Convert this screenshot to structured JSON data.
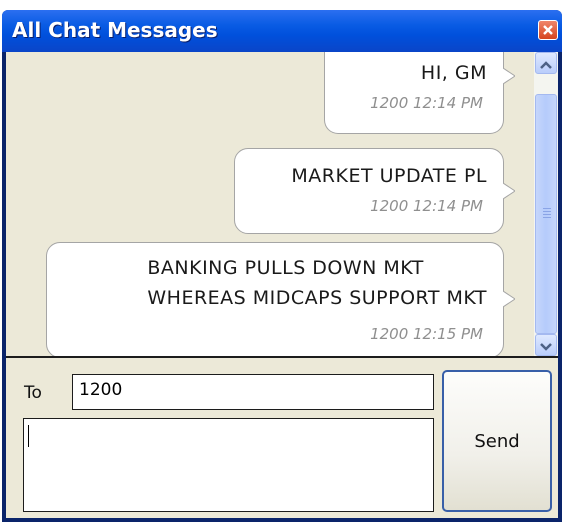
{
  "window": {
    "title": "All Chat Messages"
  },
  "messages": [
    {
      "text": "HI, GM",
      "meta": "1200 12:14 PM"
    },
    {
      "text": "MARKET UPDATE PL",
      "meta": "1200 12:14 PM"
    },
    {
      "text": "BANKING PULLS DOWN MKT\nWHEREAS MIDCAPS SUPPORT MKT",
      "meta": "1200 12:15 PM"
    }
  ],
  "compose": {
    "to_label": "To",
    "to_value": "1200",
    "message_value": "",
    "send_label": "Send"
  },
  "icons": {
    "close": "close-icon",
    "scroll_up": "chevron-up-icon",
    "scroll_down": "chevron-down-icon"
  },
  "colors": {
    "titlebar": "#0a5ce4",
    "close_button": "#d6441f",
    "bubble_bg": "#ffffff",
    "background": "#ece9d8",
    "timestamp": "#8f8f8f"
  }
}
